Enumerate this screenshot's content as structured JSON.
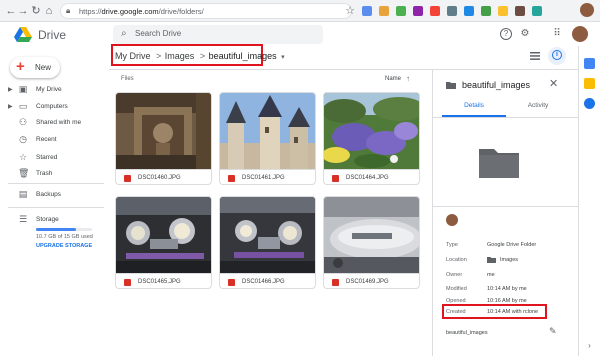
{
  "browser": {
    "url_prefix": "https://",
    "url_host": "drive.google.com",
    "url_path": "/drive/folders/",
    "back_icon": "back-arrow-icon",
    "forward_icon": "forward-arrow-icon",
    "reload_icon": "reload-icon",
    "home_icon": "home-icon",
    "star_icon": "star-icon",
    "ext_colors": [
      "#5b8def",
      "#e8a33a",
      "#4caf50",
      "#8e24aa",
      "#f44336",
      "#607d8b",
      "#1e88e5",
      "#43a047",
      "#fbc02d",
      "#6d4c41",
      "#26a69a"
    ]
  },
  "drive": {
    "brand": "Drive",
    "search_placeholder": "Search Drive",
    "help_icon": "?",
    "settings_icon": "⚙",
    "apps_icon": "⠿"
  },
  "sidebar": {
    "new_label": "New",
    "items": [
      {
        "label": "My Drive",
        "icon": "drive-icon",
        "glyph": "▣",
        "expandable": true
      },
      {
        "label": "Computers",
        "icon": "computer-icon",
        "glyph": "▭",
        "expandable": true
      },
      {
        "label": "Shared with me",
        "icon": "people-icon",
        "glyph": "⚇",
        "expandable": false
      },
      {
        "label": "Recent",
        "icon": "clock-icon",
        "glyph": "◷",
        "expandable": false
      },
      {
        "label": "Starred",
        "icon": "star-icon",
        "glyph": "☆",
        "expandable": false
      },
      {
        "label": "Trash",
        "icon": "trash-icon",
        "glyph": "🗑",
        "expandable": false
      },
      {
        "label": "Backups",
        "icon": "backup-icon",
        "glyph": "▤",
        "expandable": false
      },
      {
        "label": "Storage",
        "icon": "storage-icon",
        "glyph": "☰",
        "expandable": false
      }
    ],
    "storage_used": "10.7 GB of 15 GB used",
    "storage_fraction": 0.713,
    "upgrade_label": "UPGRADE STORAGE"
  },
  "breadcrumb": {
    "root": "My Drive",
    "middle": "Images",
    "current": "beautiful_images",
    "separator": ">",
    "dropdown": "▾"
  },
  "main": {
    "files_label": "Files",
    "sort_label": "Name",
    "sort_icon": "↑"
  },
  "files": [
    {
      "name": "DSC01460.JPG",
      "scene": "stone-carving"
    },
    {
      "name": "DSC01461.JPG",
      "scene": "castle-towers"
    },
    {
      "name": "DSC01464.JPG",
      "scene": "garden-flowers"
    },
    {
      "name": "DSC01465.JPG",
      "scene": "motorcycle-front"
    },
    {
      "name": "DSC01466.JPG",
      "scene": "motorcycle-front-2"
    },
    {
      "name": "DSC01469.JPG",
      "scene": "motorcycle-tank"
    }
  ],
  "details": {
    "title": "beautiful_images",
    "tab_details": "Details",
    "tab_activity": "Activity",
    "close_icon": "✕",
    "rows": [
      {
        "key": "Type",
        "value": "Google Drive Folder"
      },
      {
        "key": "Location",
        "value": "Images"
      },
      {
        "key": "Owner",
        "value": "me"
      },
      {
        "key": "Modified",
        "value": "10:14 AM by me"
      },
      {
        "key": "Opened",
        "value": "10:16 AM by me"
      },
      {
        "key": "Created",
        "value": "10:14 AM with rclone"
      }
    ],
    "description": "beautiful_images",
    "edit_icon": "✎"
  },
  "colors": {
    "accent": "#1a73e8",
    "highlight_box": "#e0141e",
    "folder_gray": "#5f6368"
  }
}
